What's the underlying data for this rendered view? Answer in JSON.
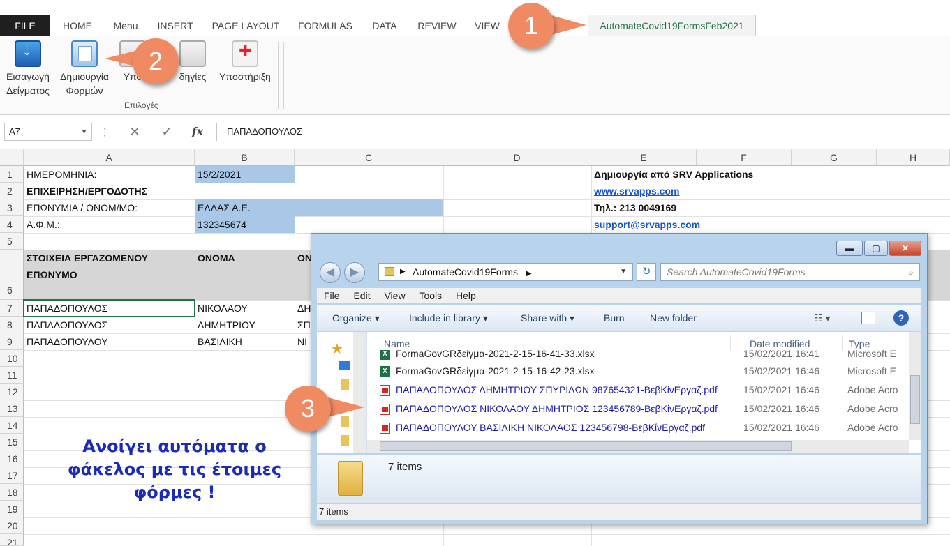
{
  "ribbon": {
    "tabs": [
      "FILE",
      "HOME",
      "Menu",
      "INSERT",
      "PAGE LAYOUT",
      "FORMULAS",
      "DATA",
      "REVIEW",
      "VIEW",
      "AutomateCovid19FormsFeb2021"
    ],
    "buttons": {
      "import_line1": "Εισαγωγή",
      "import_line2": "Δείγματος",
      "forms_line1": "Δημιουργία",
      "forms_line2": "Φορμών",
      "help_partial": "Υπο",
      "instructions_partial": "δηγίες",
      "support": "Υποστήριξη"
    },
    "group_label": "Επιλογές"
  },
  "formula_bar": {
    "name_box": "A7",
    "cancel": "✕",
    "enter": "✓",
    "fx": "fx",
    "value": "ΠΑΠΑΔΟΠΟΥΛΟΣ"
  },
  "grid": {
    "columns": [
      "A",
      "B",
      "C",
      "D",
      "E",
      "F",
      "G",
      "H"
    ],
    "rows": [
      "1",
      "2",
      "3",
      "4",
      "5",
      "6",
      "7",
      "8",
      "9",
      "10",
      "11",
      "12",
      "13",
      "14",
      "15",
      "16",
      "17",
      "18",
      "19",
      "20",
      "21"
    ],
    "cells": {
      "A1": "ΗΜΕΡΟΜΗΝΙΑ:",
      "B1": "15/2/2021",
      "E1": "Δημιουργία από SRV Applications",
      "A2": "ΕΠΙΧΕΙΡΗΣΗ/ΕΡΓΟΔΟΤΗΣ",
      "E2": "www.srvapps.com",
      "A3": "ΕΠΩΝΥΜΙΑ / ΟΝΟΜ/ΜΟ:",
      "B3": "ΕΛΛΑΣ Α.Ε.",
      "E3": "Τηλ.: 213 0049169",
      "A4": "Α.Φ.Μ.:",
      "B4": "132345674",
      "E4": "support@srvapps.com",
      "A6_line1": "ΣΤΟΙΧΕΙΑ ΕΡΓΑΖΟΜΕΝΟΥ",
      "A6_line2": "ΕΠΩΝΥΜΟ",
      "B6": "ΟΝΟΜΑ",
      "C6": "ΟΝ",
      "A7": "ΠΑΠΑΔΟΠΟΥΛΟΣ",
      "B7": "ΝΙΚΟΛΑΟΥ",
      "C7": "ΔΗ",
      "A8": "ΠΑΠΑΔΟΠΟΥΛΟΣ",
      "B8": "ΔΗΜΗΤΡΙΟΥ",
      "C8": "ΣΠ",
      "A9": "ΠΑΠΑΔΟΠΟΥΛΟΥ",
      "B9": "ΒΑΣΙΛΙΚΗ",
      "C9": "ΝΙ"
    },
    "note_line1": "Ανοίγει αυτόματα ο",
    "note_line2": "φάκελος με τις έτοιμες",
    "note_line3": "φόρμες !"
  },
  "explorer": {
    "minimize": "▬",
    "maximize": "▢",
    "close": "✕",
    "back": "◀",
    "forward": "▶",
    "address": "AutomateCovid19Forms",
    "refresh": "↻",
    "search_placeholder": "Search AutomateCovid19Forms",
    "menu": [
      "File",
      "Edit",
      "View",
      "Tools",
      "Help"
    ],
    "commands": [
      "Organize ▾",
      "Include in library ▾",
      "Share with ▾",
      "Burn",
      "New folder"
    ],
    "views_icon": "☷ ▾",
    "help_icon": "?",
    "columns": [
      "Name",
      "Date modified",
      "Type"
    ],
    "files": [
      {
        "name": "FormaGovGRδείγμα-2021-2-15-16-41-33.xlsx",
        "date": "15/02/2021 16:41",
        "type": "Microsoft E",
        "kind": "xl"
      },
      {
        "name": "FormaGovGRδείγμα-2021-2-15-16-42-23.xlsx",
        "date": "15/02/2021 16:46",
        "type": "Microsoft E",
        "kind": "xl"
      },
      {
        "name": "ΠΑΠΑΔΟΠΟΥΛΟΣ ΔΗΜΗΤΡΙΟΥ ΣΠΥΡΙΔΩΝ 987654321-ΒεβΚίνΕργαζ.pdf",
        "date": "15/02/2021 16:46",
        "type": "Adobe Acro",
        "kind": "pdf"
      },
      {
        "name": "ΠΑΠΑΔΟΠΟΥΛΟΣ ΝΙΚΟΛΑΟΥ ΔΗΜΗΤΡΙΟΣ 123456789-ΒεβΚίνΕργαζ.pdf",
        "date": "15/02/2021 16:46",
        "type": "Adobe Acro",
        "kind": "pdf"
      },
      {
        "name": "ΠΑΠΑΔΟΠΟΥΛΟΥ ΒΑΣΙΛΙΚΗ ΝΙΚΟΛΑΟΣ 123456798-ΒεβΚίνΕργαζ.pdf",
        "date": "15/02/2021 16:46",
        "type": "Adobe Acro",
        "kind": "pdf"
      }
    ],
    "xl_badge": "X",
    "item_count": "7 items",
    "status": "7 items"
  },
  "callouts": [
    "1",
    "2",
    "3"
  ],
  "colors": {
    "callout": "#ef8a62",
    "note_text": "#1b2bb5",
    "selected_fill": "#a9c7e6",
    "header_fill": "#d6d6d6",
    "custom_tab_text": "#217346"
  }
}
